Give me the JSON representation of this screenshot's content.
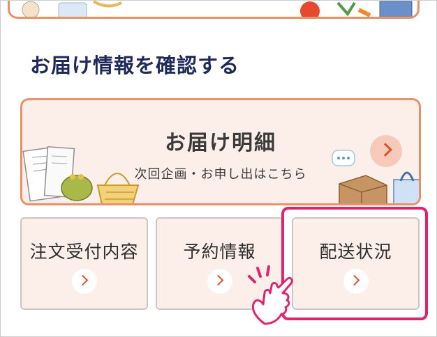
{
  "section": {
    "title": "お届け情報を確認する"
  },
  "detail_card": {
    "title": "お届け明細",
    "subtitle": "次回企画・お申し出はこちら"
  },
  "buttons": [
    {
      "label": "注文受付内容"
    },
    {
      "label": "予約情報"
    },
    {
      "label": "配送状況"
    }
  ],
  "colors": {
    "accent_border": "#e8906a",
    "card_bg": "#fcefe9",
    "arrow": "#d9542a",
    "title_navy": "#1e2a5a",
    "highlight": "#e0236c"
  },
  "icons": [
    "chevron-right-icon",
    "hand-pointer-icon"
  ]
}
